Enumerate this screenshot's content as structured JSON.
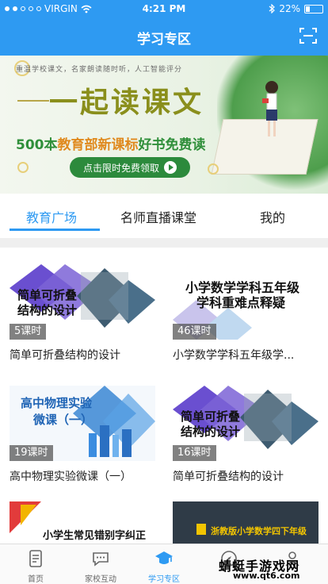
{
  "status_bar": {
    "carrier": "VIRGIN",
    "time": "4:21 PM",
    "battery": "22%"
  },
  "header": {
    "title": "学习专区"
  },
  "banner": {
    "subtitle": "重温学校课文，名家朗读随时听，人工智能评分",
    "title": "一起读课文",
    "promo_prefix": "500本",
    "promo_highlight": "教育部新课标",
    "promo_suffix": "好书免费读",
    "button_label": "点击限时免费领取"
  },
  "tabs": [
    {
      "label": "教育广场",
      "active": true
    },
    {
      "label": "名师直播课堂",
      "active": false
    },
    {
      "label": "我的",
      "active": false
    }
  ],
  "courses": [
    {
      "thumb_text": [
        "简单可折叠",
        "结构的设计"
      ],
      "lessons": "5课时",
      "title": "简单可折叠结构的设计"
    },
    {
      "thumb_text": [
        "小学数学学科五年级",
        "学科重难点释疑"
      ],
      "lessons": "46课时",
      "title": "小学数学学科五年级学..."
    },
    {
      "thumb_text": [
        "高中物理实验",
        "微课（一）"
      ],
      "lessons": "19课时",
      "title": "高中物理实验微课（一）"
    },
    {
      "thumb_text": [
        "简单可折叠",
        "结构的设计"
      ],
      "lessons": "16课时",
      "title": "简单可折叠结构的设计"
    },
    {
      "thumb_text": [
        "小学生常见错别字纠正"
      ],
      "lessons": "",
      "title": ""
    },
    {
      "thumb_text": [
        "浙教版小学数学四下年级"
      ],
      "lessons": "",
      "title": ""
    }
  ],
  "bottom_nav": [
    {
      "label": "首页",
      "icon": "document-icon",
      "active": false
    },
    {
      "label": "家校互动",
      "icon": "chat-bubble-icon",
      "active": false
    },
    {
      "label": "学习专区",
      "icon": "graduation-cap-icon",
      "active": true
    },
    {
      "label": "",
      "icon": "compass-icon",
      "active": false
    },
    {
      "label": "",
      "icon": "person-icon",
      "active": false
    }
  ],
  "watermark": {
    "text": "蜻蜓手游戏网",
    "url": "www.qt6.com"
  },
  "colors": {
    "primary": "#2e9af2",
    "banner_green": "#2c8a3c",
    "banner_title": "#8a8f1c",
    "purple": "#6a4fd0"
  }
}
